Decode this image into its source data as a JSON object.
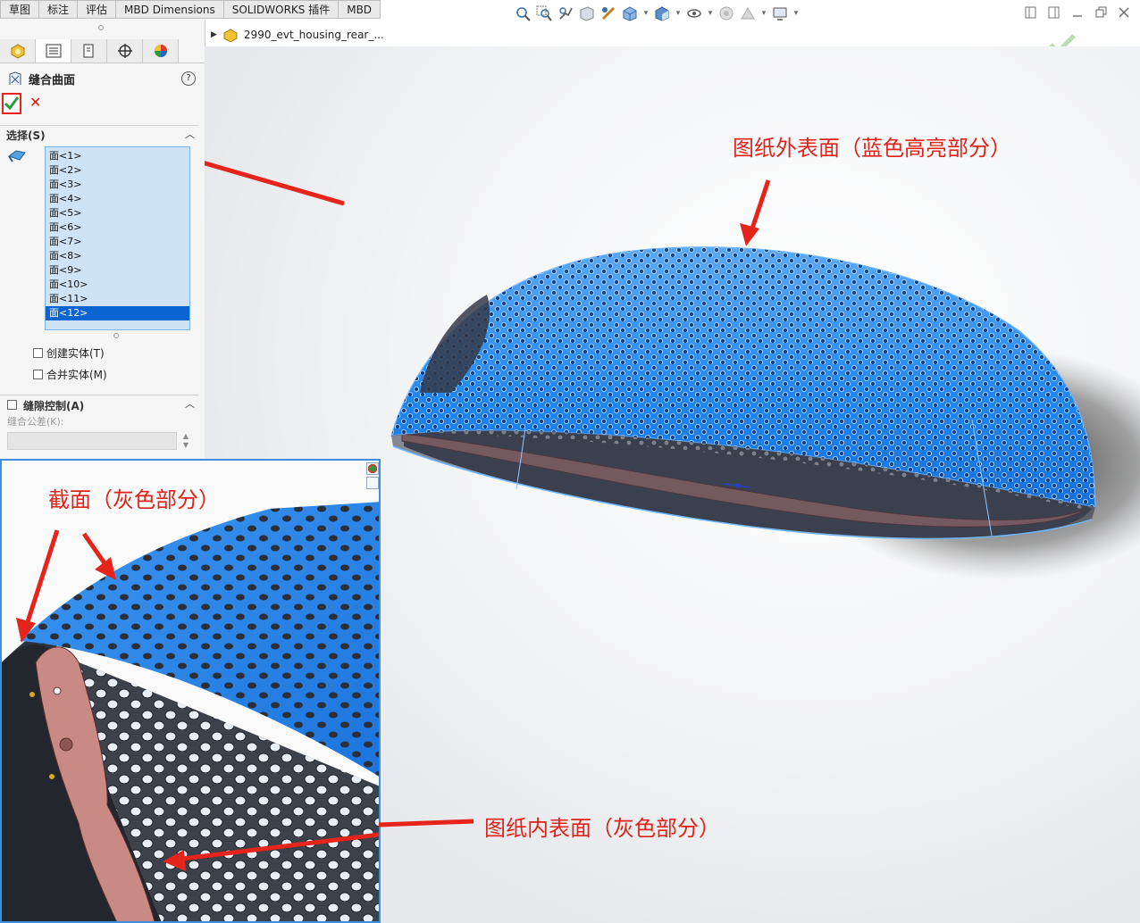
{
  "command_tabs": [
    "草图",
    "标注",
    "评估",
    "MBD Dimensions",
    "SOLIDWORKS 插件",
    "MBD"
  ],
  "hud_icons": [
    "zoom-to-fit-icon",
    "zoom-area-icon",
    "previous-view-icon",
    "section-view-icon",
    "dynamic-annotation-icon",
    "view-orientation-icon",
    "display-style-icon",
    "hide-show-icon",
    "edit-appearance-icon",
    "apply-scene-icon",
    "view-settings-icon"
  ],
  "property_manager": {
    "title": "缝合曲面",
    "help_label": "?",
    "cancel_label": "✕",
    "selection": {
      "title": "选择(S)",
      "faces": [
        "面<1>",
        "面<2>",
        "面<3>",
        "面<4>",
        "面<5>",
        "面<6>",
        "面<7>",
        "面<8>",
        "面<9>",
        "面<10>",
        "面<11>",
        "面<12>"
      ],
      "selected_index": 11
    },
    "create_solid_label": "创建实体(T)",
    "merge_entities_label": "合并实体(M)",
    "gap_control": {
      "title": "缝隙控制(A)",
      "tolerance_label": "缝合公差(K):",
      "tolerance_value": ""
    }
  },
  "feature_tree": {
    "part_name": "2990_evt_housing_rear_..."
  },
  "annotations": {
    "outer_surface": "图纸外表面（蓝色高亮部分）",
    "section_face": "截面（灰色部分）",
    "inner_surface": "图纸内表面（灰色部分）"
  },
  "colors": {
    "highlight_blue": "#1f86f0",
    "annotation_red": "#e0231a",
    "flange_pink": "#c98a86"
  }
}
